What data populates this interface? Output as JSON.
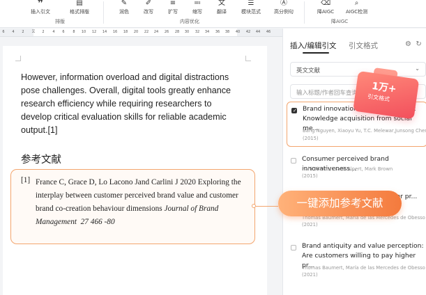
{
  "ribbon": {
    "tools": [
      {
        "icon": "quote-icon",
        "label": "插入引文"
      },
      {
        "icon": "format-icon",
        "label": "格式排版"
      },
      {
        "icon": "polish-icon",
        "label": "润色"
      },
      {
        "icon": "rewrite-icon",
        "label": "改写"
      },
      {
        "icon": "expand-icon",
        "label": "扩写"
      },
      {
        "icon": "shorten-icon",
        "label": "缩写"
      },
      {
        "icon": "translate-icon",
        "label": "翻译"
      },
      {
        "icon": "module-icon",
        "label": "模块范式"
      },
      {
        "icon": "example-icon",
        "label": "高分例句"
      },
      {
        "icon": "reduce-aigc-icon",
        "label": "降AIGC"
      },
      {
        "icon": "aigc-check-icon",
        "label": "AIGC检测"
      }
    ],
    "groups": [
      "排版",
      "内容优化",
      "降AIGC"
    ]
  },
  "ruler": {
    "left_ticks": [
      "6",
      "4",
      "2"
    ],
    "right_ticks": [
      "2",
      "4",
      "6",
      "8",
      "10",
      "12",
      "14",
      "16",
      "18",
      "20",
      "22",
      "24",
      "26",
      "28",
      "30",
      "32",
      "34",
      "36",
      "38",
      "40",
      "42",
      "44",
      "46"
    ]
  },
  "document": {
    "paragraph": "However, information overload and digital distractions pose challenges. Overall, digital tools greatly enhance research efficiency while requiring researchers to develop critical evaluation skills for reliable academic output.[1]",
    "heading": "参考文献",
    "reference": {
      "number": "[1]",
      "text_plain": "France C, Grace D, Lo Lacono Jand Carlini J 2020 Exploring the interplay between customer perceived brand value and customer brand co-creation behaviour dimensions ",
      "journal": "Journal of Brand Management",
      "volume_pages": "27 466 -80"
    }
  },
  "panel": {
    "tab_active": "插入/编辑引文",
    "tab_inactive": "引文格式",
    "select_value": "英文文献",
    "search_placeholder": "输入标题/作者回车查询",
    "results": [
      {
        "checked": true,
        "title": "Brand innovation and social media: Knowledge acquisition from social me...",
        "authors": "Bang Nguyen, Xiaoyu Yu, T.C. Melewar,Junsong Chen",
        "year": "(2015)"
      },
      {
        "checked": false,
        "title": "Consumer perceived brand innovativeness...",
        "authors": "Rahi Shams, Frank Alpert, Mark Brown",
        "year": "(2015)"
      },
      {
        "checked": false,
        "title": "ption: er pr...",
        "authors": "Thomas Baumert, María de las Mercedes de Obesso",
        "year": "(2021)"
      },
      {
        "checked": false,
        "title": "Brand antiquity and value perception: Are customers willing to pay higher pr...",
        "authors": "Thomas Baumert, María de las Mercedes de Obesso",
        "year": "(2021)"
      }
    ]
  },
  "promo": {
    "cta": "一键添加参考文献",
    "badge_big": "1万+",
    "badge_small": "引文格式"
  },
  "colors": {
    "accent": "#f47a3d",
    "outline": "#f3a56e",
    "badge": "#f24f5c"
  }
}
